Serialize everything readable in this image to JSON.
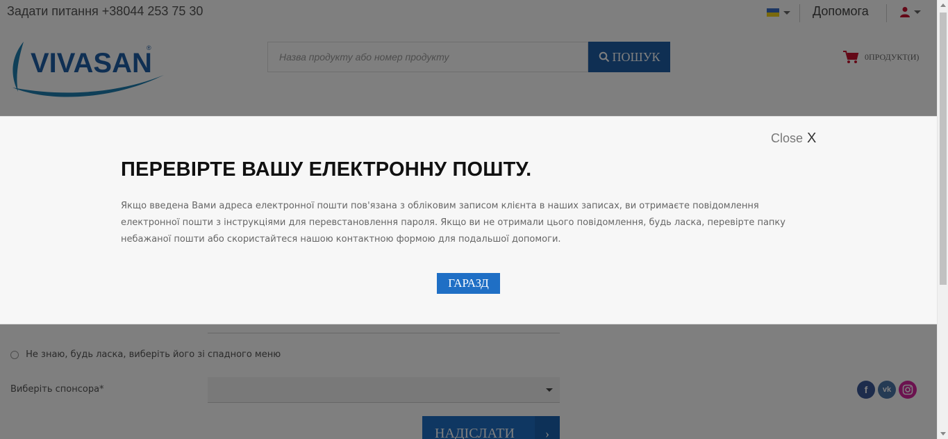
{
  "header": {
    "phone": "Задати питання +38044 253 75 30",
    "help": "Допомога",
    "logo_text": "VIVASAN"
  },
  "search": {
    "placeholder": "Назва продукту або номер продукту",
    "button_label": "ПОШУК"
  },
  "cart": {
    "label": "0ПРОДУКТ(И)"
  },
  "form": {
    "radio_label": "Не знаю, будь ласка, виберіть його зі спадного меню",
    "sponsor_label": "Виберіть спонсора*",
    "submit_label": "НАДІСЛАТИ"
  },
  "modal": {
    "close_label": "Close",
    "close_x": "X",
    "title": "ПЕРЕВІРТЕ ВАШУ ЕЛЕКТРОННУ ПОШТУ.",
    "message": "Якщо введена Вами адреса електронної пошти пов'язана з обліковим записом клієнта в наших записах, ви отримаєте повідомлення електронної пошти з інструкціями для перевстановлення пароля. Якщо ви не отримали цього повідомлення, будь ласка, перевірте папку небажаної пошти або скористайтеся нашою контактною формою для подальшої допомоги.",
    "ok_label": "ГАРАЗД"
  },
  "social": {
    "facebook": "f",
    "vk": "vk",
    "instagram": "ig"
  },
  "colors": {
    "primary_blue": "#1f6fc5",
    "search_blue": "#1f5fa6",
    "cart_red": "#c8102e",
    "facebook": "#3b5998",
    "vk": "#4a76a8",
    "instagram": "#d6249f"
  }
}
